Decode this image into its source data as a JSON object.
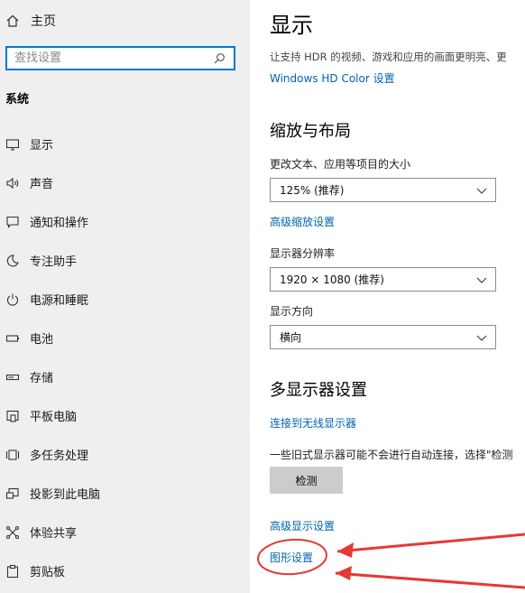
{
  "sidebar": {
    "home_label": "主页",
    "search_placeholder": "查找设置",
    "section_title": "系统",
    "items": [
      {
        "label": "显示",
        "icon": "monitor-icon"
      },
      {
        "label": "声音",
        "icon": "speaker-icon"
      },
      {
        "label": "通知和操作",
        "icon": "notification-icon"
      },
      {
        "label": "专注助手",
        "icon": "moon-icon"
      },
      {
        "label": "电源和睡眠",
        "icon": "power-icon"
      },
      {
        "label": "电池",
        "icon": "battery-icon"
      },
      {
        "label": "存储",
        "icon": "storage-icon"
      },
      {
        "label": "平板电脑",
        "icon": "tablet-icon"
      },
      {
        "label": "多任务处理",
        "icon": "multitasking-icon"
      },
      {
        "label": "投影到此电脑",
        "icon": "project-icon"
      },
      {
        "label": "体验共享",
        "icon": "share-icon"
      },
      {
        "label": "剪贴板",
        "icon": "clipboard-icon"
      }
    ]
  },
  "main": {
    "title": "显示",
    "hdr_desc": "让支持 HDR 的视频、游戏和应用的画面更明亮、更",
    "hdr_link": "Windows HD Color 设置",
    "scale_section": "缩放与布局",
    "scale_label": "更改文本、应用等项目的大小",
    "scale_value": "125% (推荐)",
    "advanced_scaling_link": "高级缩放设置",
    "resolution_label": "显示器分辨率",
    "resolution_value": "1920 × 1080 (推荐)",
    "orientation_label": "显示方向",
    "orientation_value": "横向",
    "multi_section": "多显示器设置",
    "wireless_link": "连接到无线显示器",
    "detect_desc": "一些旧式显示器可能不会进行自动连接，选择\"检测",
    "detect_button": "检测",
    "advanced_display_link": "高级显示设置",
    "graphics_link": "图形设置"
  },
  "colors": {
    "accent": "#0078d7",
    "link": "#0063b1",
    "sidebar_bg": "#efefef",
    "annotation": "#e53935"
  }
}
